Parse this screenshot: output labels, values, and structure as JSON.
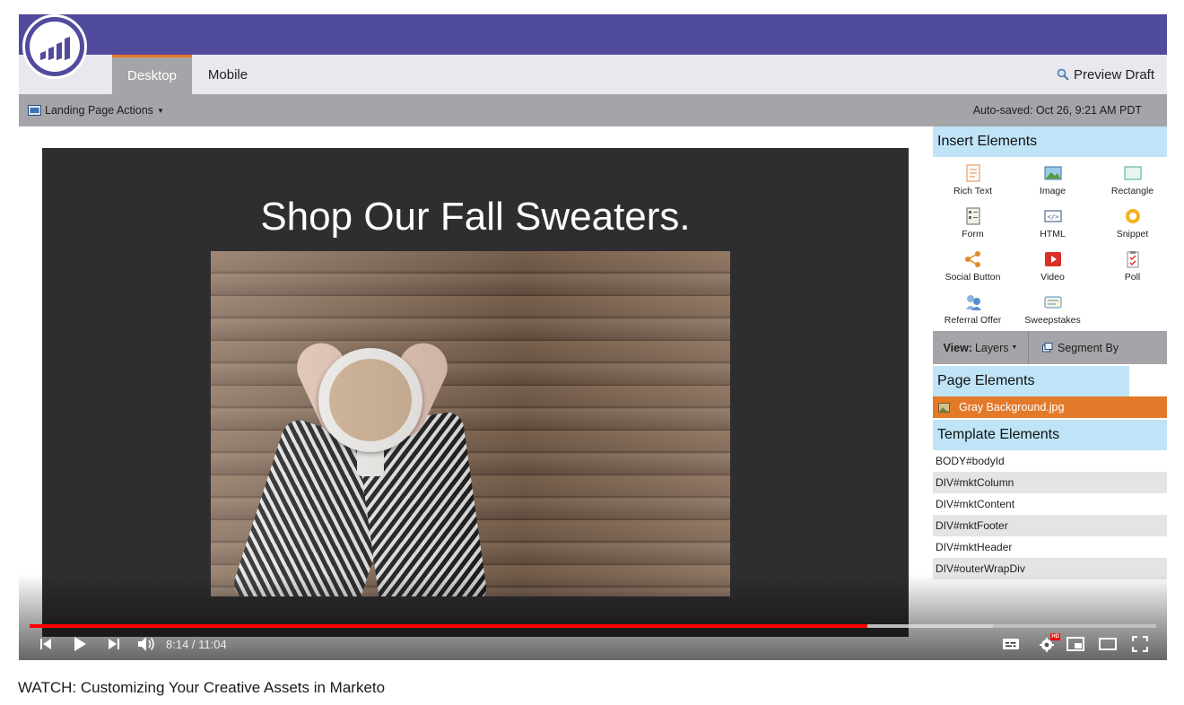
{
  "marketo": {
    "tabs": [
      {
        "label": "Desktop",
        "active": true
      },
      {
        "label": "Mobile",
        "active": false
      }
    ],
    "preview_label": "Preview Draft",
    "actions_label": "Landing Page Actions",
    "autosave_text": "Auto-saved: Oct 26, 9:21 AM PDT",
    "accent_color": "#514b9d",
    "highlight_color": "#e37a2a"
  },
  "landing_page": {
    "headline": "Shop Our Fall Sweaters."
  },
  "panel": {
    "insert_title": "Insert Elements",
    "insert_items": [
      {
        "label": "Rich Text",
        "icon": "rich-text-icon"
      },
      {
        "label": "Image",
        "icon": "image-icon"
      },
      {
        "label": "Rectangle",
        "icon": "rectangle-icon"
      },
      {
        "label": "Form",
        "icon": "form-icon"
      },
      {
        "label": "HTML",
        "icon": "html-icon"
      },
      {
        "label": "Snippet",
        "icon": "snippet-icon"
      },
      {
        "label": "Social Button",
        "icon": "social-button-icon"
      },
      {
        "label": "Video",
        "icon": "video-icon"
      },
      {
        "label": "Poll",
        "icon": "poll-icon"
      },
      {
        "label": "Referral Offer",
        "icon": "referral-offer-icon"
      },
      {
        "label": "Sweepstakes",
        "icon": "sweepstakes-icon"
      }
    ],
    "view_label": "View:",
    "view_value": "Layers",
    "segment_label": "Segment By",
    "page_elements_title": "Page Elements",
    "page_elements": [
      "Gray Background.jpg"
    ],
    "template_elements_title": "Template Elements",
    "template_elements": [
      "BODY#bodyId",
      "DIV#mktColumn",
      "DIV#mktContent",
      "DIV#mktFooter",
      "DIV#mktHeader",
      "DIV#outerWrapDiv"
    ]
  },
  "player": {
    "time": "8:14 / 11:04",
    "played_fraction": 0.744,
    "buffered_fraction": 0.855,
    "hd_badge": "HD"
  },
  "video_title": "WATCH: Customizing Your Creative Assets in Marketo"
}
